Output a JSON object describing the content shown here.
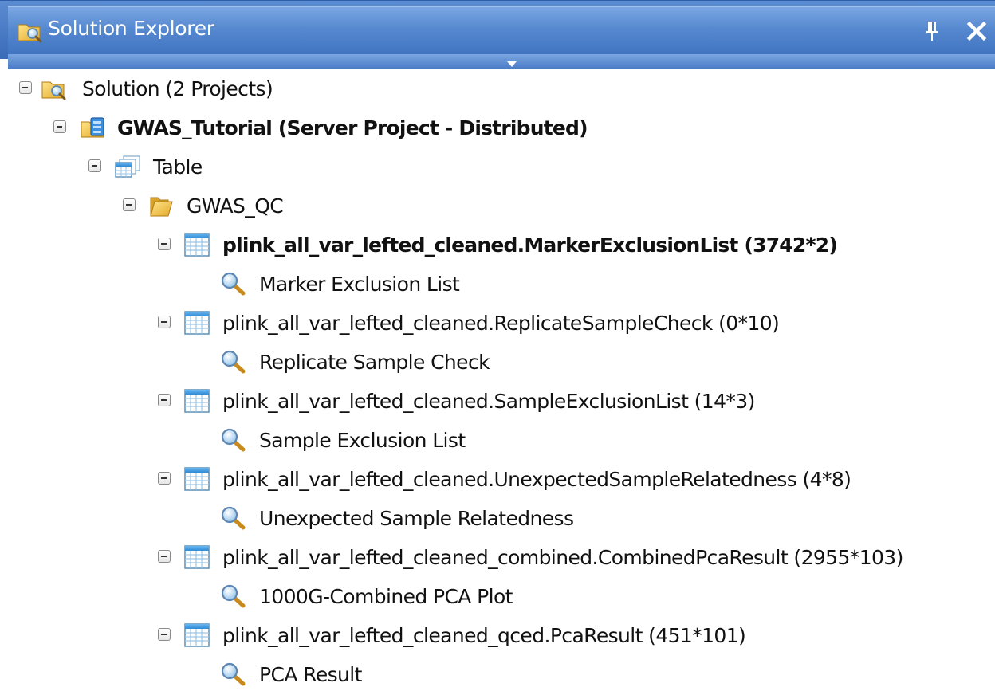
{
  "window": {
    "title": "Solution Explorer",
    "icons": {
      "title": "solution-explorer-icon",
      "pin": "pin-icon",
      "close": "close-icon"
    },
    "accent_color": "#4f84cc"
  },
  "tree": {
    "solution": {
      "label": "Solution (2 Projects)",
      "icon": "solution-icon",
      "expanded": true
    },
    "project": {
      "label": "GWAS_Tutorial (Server Project - Distributed)",
      "icon": "server-project-icon",
      "expanded": true
    },
    "table_folder": {
      "label": "Table",
      "icon": "table-stack-icon",
      "expanded": true
    },
    "qc_folder": {
      "label": "GWAS_QC",
      "icon": "folder-icon",
      "expanded": true
    },
    "tables": [
      {
        "label": "plink_all_var_lefted_cleaned.MarkerExclusionList (3742*2)",
        "bold": true,
        "view": "Marker Exclusion List"
      },
      {
        "label": "plink_all_var_lefted_cleaned.ReplicateSampleCheck (0*10)",
        "bold": false,
        "view": "Replicate Sample Check"
      },
      {
        "label": "plink_all_var_lefted_cleaned.SampleExclusionList (14*3)",
        "bold": false,
        "view": "Sample Exclusion List"
      },
      {
        "label": "plink_all_var_lefted_cleaned.UnexpectedSampleRelatedness (4*8)",
        "bold": false,
        "view": "Unexpected Sample Relatedness"
      },
      {
        "label": "plink_all_var_lefted_cleaned_combined.CombinedPcaResult (2955*103)",
        "bold": false,
        "view": "1000G-Combined PCA Plot"
      },
      {
        "label": "plink_all_var_lefted_cleaned_qced.PcaResult (451*101)",
        "bold": false,
        "view": "PCA Result"
      }
    ]
  }
}
